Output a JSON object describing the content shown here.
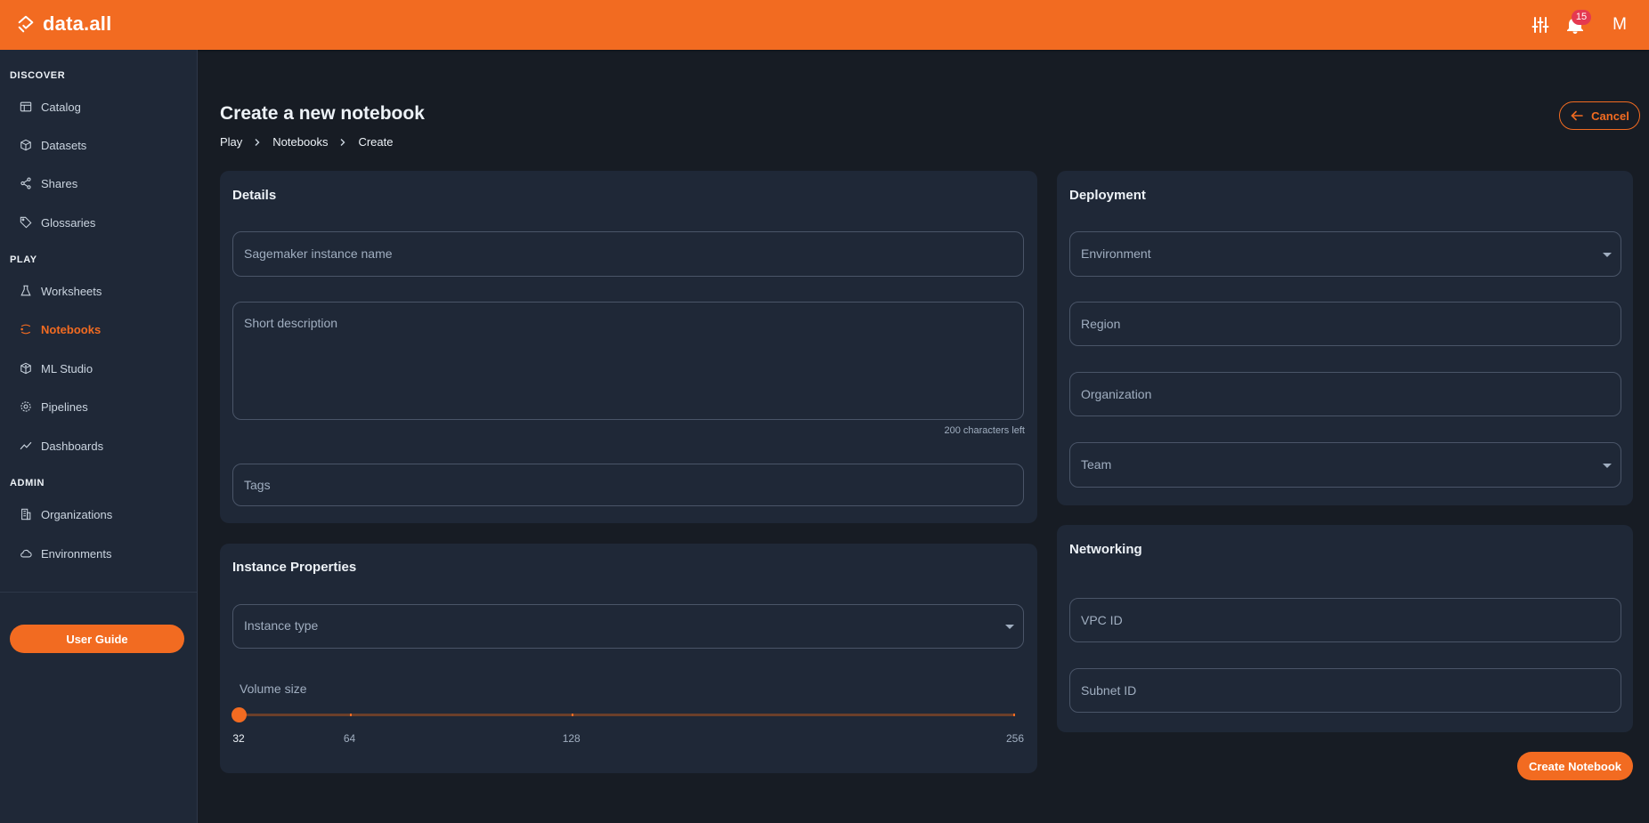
{
  "app": {
    "logo_text": "data.all",
    "brand_color": "#f26b21",
    "notifications_count": "15",
    "avatar_initial": "M",
    "icons": [
      "settings-sliders-icon",
      "bell-icon"
    ]
  },
  "sidebar": {
    "sections": [
      {
        "label": "DISCOVER",
        "items": [
          {
            "label": "Catalog",
            "icon": "catalog-icon"
          },
          {
            "label": "Datasets",
            "icon": "datasets-icon"
          },
          {
            "label": "Shares",
            "icon": "share-icon"
          },
          {
            "label": "Glossaries",
            "icon": "tag-icon"
          }
        ]
      },
      {
        "label": "PLAY",
        "items": [
          {
            "label": "Worksheets",
            "icon": "flask-icon"
          },
          {
            "label": "Notebooks",
            "icon": "notebook-icon",
            "active": true
          },
          {
            "label": "ML Studio",
            "icon": "cube-icon"
          },
          {
            "label": "Pipelines",
            "icon": "gear-icon"
          },
          {
            "label": "Dashboards",
            "icon": "chart-line-icon"
          }
        ]
      },
      {
        "label": "ADMIN",
        "items": [
          {
            "label": "Organizations",
            "icon": "building-icon"
          },
          {
            "label": "Environments",
            "icon": "cloud-icon"
          }
        ]
      }
    ],
    "user_guide_label": "User Guide"
  },
  "page": {
    "title": "Create a new notebook",
    "breadcrumb": [
      "Play",
      "Notebooks",
      "Create"
    ],
    "cancel_label": "Cancel"
  },
  "details": {
    "title": "Details",
    "name_placeholder": "Sagemaker instance name",
    "description_placeholder": "Short description",
    "chars_left": "200 characters left",
    "tags_placeholder": "Tags"
  },
  "instance": {
    "title": "Instance Properties",
    "type_placeholder": "Instance type",
    "volume_label": "Volume size",
    "volume_value": 32,
    "volume_min": 32,
    "volume_max": 256,
    "volume_marks": [
      "32",
      "64",
      "128",
      "256"
    ]
  },
  "deployment": {
    "title": "Deployment",
    "environment_placeholder": "Environment",
    "region_placeholder": "Region",
    "organization_placeholder": "Organization",
    "team_placeholder": "Team"
  },
  "networking": {
    "title": "Networking",
    "vpc_placeholder": "VPC ID",
    "subnet_placeholder": "Subnet ID"
  },
  "create_label": "Create Notebook"
}
